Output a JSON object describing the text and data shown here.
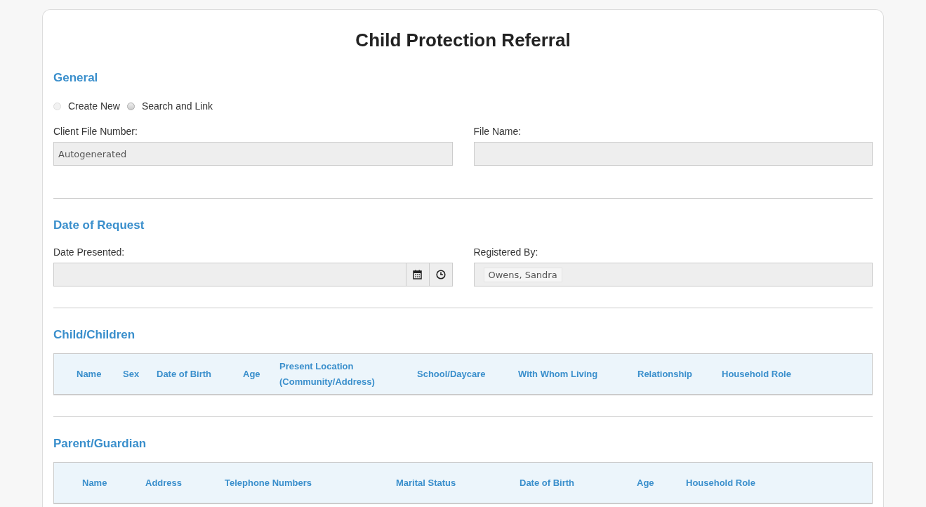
{
  "title": "Child Protection Referral",
  "general": {
    "heading": "General",
    "options": [
      {
        "label": "Create New",
        "selected": false,
        "disabled": true
      },
      {
        "label": "Search and Link",
        "selected": false,
        "disabled": false
      }
    ],
    "fields": [
      {
        "label": "Client File Number:",
        "placeholder": "Autogenerated"
      },
      {
        "label": "File Name:"
      }
    ]
  },
  "date_of_request": {
    "heading": "Date of Request",
    "date_label": "Date Presented:",
    "registered_label": "Registered By:",
    "registered_tag": "Owens, Sandra"
  },
  "tables": [
    {
      "heading": "Child/Children",
      "columns": [
        "Name",
        "Sex",
        "Date of Birth",
        "Age",
        "Present Location (Community/Address)",
        "School/Daycare",
        "With Whom Living",
        "Relationship",
        "Household Role"
      ]
    },
    {
      "heading": "Parent/Guardian",
      "columns": [
        "Name",
        "Address",
        "Telephone Numbers",
        "Marital Status",
        "Date of Birth",
        "Age",
        "Household Role"
      ]
    }
  ]
}
